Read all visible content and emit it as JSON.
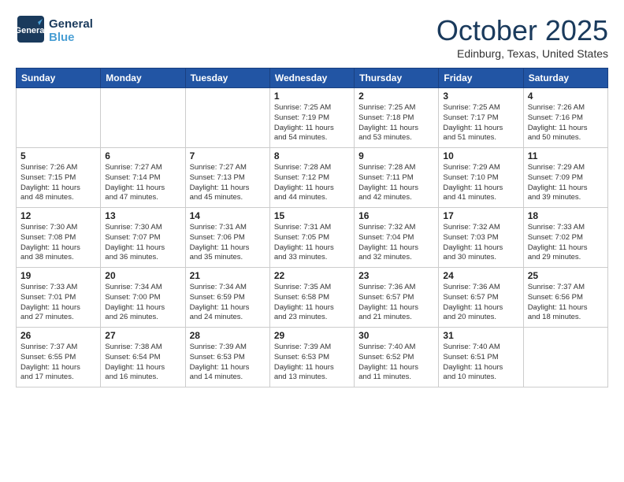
{
  "header": {
    "logo_line1": "General",
    "logo_line2": "Blue",
    "month": "October 2025",
    "location": "Edinburg, Texas, United States"
  },
  "weekdays": [
    "Sunday",
    "Monday",
    "Tuesday",
    "Wednesday",
    "Thursday",
    "Friday",
    "Saturday"
  ],
  "weeks": [
    [
      {
        "day": "",
        "detail": ""
      },
      {
        "day": "",
        "detail": ""
      },
      {
        "day": "",
        "detail": ""
      },
      {
        "day": "1",
        "detail": "Sunrise: 7:25 AM\nSunset: 7:19 PM\nDaylight: 11 hours\nand 54 minutes."
      },
      {
        "day": "2",
        "detail": "Sunrise: 7:25 AM\nSunset: 7:18 PM\nDaylight: 11 hours\nand 53 minutes."
      },
      {
        "day": "3",
        "detail": "Sunrise: 7:25 AM\nSunset: 7:17 PM\nDaylight: 11 hours\nand 51 minutes."
      },
      {
        "day": "4",
        "detail": "Sunrise: 7:26 AM\nSunset: 7:16 PM\nDaylight: 11 hours\nand 50 minutes."
      }
    ],
    [
      {
        "day": "5",
        "detail": "Sunrise: 7:26 AM\nSunset: 7:15 PM\nDaylight: 11 hours\nand 48 minutes."
      },
      {
        "day": "6",
        "detail": "Sunrise: 7:27 AM\nSunset: 7:14 PM\nDaylight: 11 hours\nand 47 minutes."
      },
      {
        "day": "7",
        "detail": "Sunrise: 7:27 AM\nSunset: 7:13 PM\nDaylight: 11 hours\nand 45 minutes."
      },
      {
        "day": "8",
        "detail": "Sunrise: 7:28 AM\nSunset: 7:12 PM\nDaylight: 11 hours\nand 44 minutes."
      },
      {
        "day": "9",
        "detail": "Sunrise: 7:28 AM\nSunset: 7:11 PM\nDaylight: 11 hours\nand 42 minutes."
      },
      {
        "day": "10",
        "detail": "Sunrise: 7:29 AM\nSunset: 7:10 PM\nDaylight: 11 hours\nand 41 minutes."
      },
      {
        "day": "11",
        "detail": "Sunrise: 7:29 AM\nSunset: 7:09 PM\nDaylight: 11 hours\nand 39 minutes."
      }
    ],
    [
      {
        "day": "12",
        "detail": "Sunrise: 7:30 AM\nSunset: 7:08 PM\nDaylight: 11 hours\nand 38 minutes."
      },
      {
        "day": "13",
        "detail": "Sunrise: 7:30 AM\nSunset: 7:07 PM\nDaylight: 11 hours\nand 36 minutes."
      },
      {
        "day": "14",
        "detail": "Sunrise: 7:31 AM\nSunset: 7:06 PM\nDaylight: 11 hours\nand 35 minutes."
      },
      {
        "day": "15",
        "detail": "Sunrise: 7:31 AM\nSunset: 7:05 PM\nDaylight: 11 hours\nand 33 minutes."
      },
      {
        "day": "16",
        "detail": "Sunrise: 7:32 AM\nSunset: 7:04 PM\nDaylight: 11 hours\nand 32 minutes."
      },
      {
        "day": "17",
        "detail": "Sunrise: 7:32 AM\nSunset: 7:03 PM\nDaylight: 11 hours\nand 30 minutes."
      },
      {
        "day": "18",
        "detail": "Sunrise: 7:33 AM\nSunset: 7:02 PM\nDaylight: 11 hours\nand 29 minutes."
      }
    ],
    [
      {
        "day": "19",
        "detail": "Sunrise: 7:33 AM\nSunset: 7:01 PM\nDaylight: 11 hours\nand 27 minutes."
      },
      {
        "day": "20",
        "detail": "Sunrise: 7:34 AM\nSunset: 7:00 PM\nDaylight: 11 hours\nand 26 minutes."
      },
      {
        "day": "21",
        "detail": "Sunrise: 7:34 AM\nSunset: 6:59 PM\nDaylight: 11 hours\nand 24 minutes."
      },
      {
        "day": "22",
        "detail": "Sunrise: 7:35 AM\nSunset: 6:58 PM\nDaylight: 11 hours\nand 23 minutes."
      },
      {
        "day": "23",
        "detail": "Sunrise: 7:36 AM\nSunset: 6:57 PM\nDaylight: 11 hours\nand 21 minutes."
      },
      {
        "day": "24",
        "detail": "Sunrise: 7:36 AM\nSunset: 6:57 PM\nDaylight: 11 hours\nand 20 minutes."
      },
      {
        "day": "25",
        "detail": "Sunrise: 7:37 AM\nSunset: 6:56 PM\nDaylight: 11 hours\nand 18 minutes."
      }
    ],
    [
      {
        "day": "26",
        "detail": "Sunrise: 7:37 AM\nSunset: 6:55 PM\nDaylight: 11 hours\nand 17 minutes."
      },
      {
        "day": "27",
        "detail": "Sunrise: 7:38 AM\nSunset: 6:54 PM\nDaylight: 11 hours\nand 16 minutes."
      },
      {
        "day": "28",
        "detail": "Sunrise: 7:39 AM\nSunset: 6:53 PM\nDaylight: 11 hours\nand 14 minutes."
      },
      {
        "day": "29",
        "detail": "Sunrise: 7:39 AM\nSunset: 6:53 PM\nDaylight: 11 hours\nand 13 minutes."
      },
      {
        "day": "30",
        "detail": "Sunrise: 7:40 AM\nSunset: 6:52 PM\nDaylight: 11 hours\nand 11 minutes."
      },
      {
        "day": "31",
        "detail": "Sunrise: 7:40 AM\nSunset: 6:51 PM\nDaylight: 11 hours\nand 10 minutes."
      },
      {
        "day": "",
        "detail": ""
      }
    ]
  ]
}
